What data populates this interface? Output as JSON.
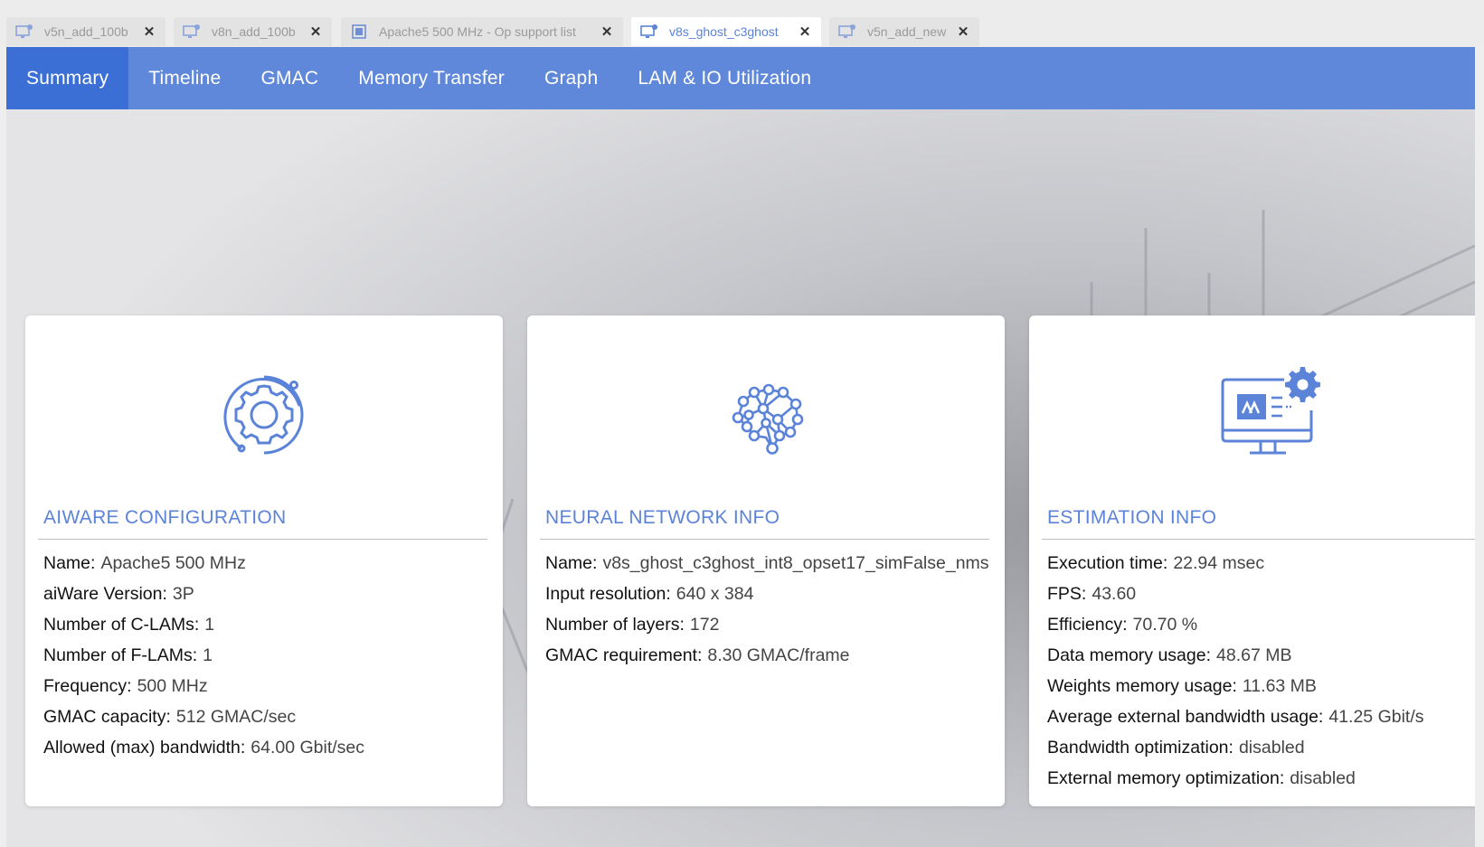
{
  "tabs": [
    {
      "label": "v5n_add_100b",
      "icon": "monitor-icon",
      "active": false
    },
    {
      "label": "v8n_add_100b",
      "icon": "monitor-icon",
      "active": false
    },
    {
      "label": "Apache5 500 MHz - Op support list",
      "icon": "chip-icon",
      "active": false
    },
    {
      "label": "v8s_ghost_c3ghost",
      "icon": "monitor-icon",
      "active": true
    },
    {
      "label": "v5n_add_new",
      "icon": "monitor-icon",
      "active": false
    }
  ],
  "nav": {
    "items": [
      "Summary",
      "Timeline",
      "GMAC",
      "Memory Transfer",
      "Graph",
      "LAM & IO Utilization"
    ],
    "active": "Summary"
  },
  "cards": {
    "aiware": {
      "icon": "gear-icon",
      "title": "AIWARE CONFIGURATION",
      "rows": [
        {
          "key": "Name:",
          "value": "Apache5 500 MHz"
        },
        {
          "key": "aiWare Version:",
          "value": "3P"
        },
        {
          "key": "Number of C-LAMs:",
          "value": "1"
        },
        {
          "key": "Number of F-LAMs:",
          "value": "1"
        },
        {
          "key": "Frequency:",
          "value": "500 MHz"
        },
        {
          "key": "GMAC capacity:",
          "value": "512 GMAC/sec"
        },
        {
          "key": "Allowed (max) bandwidth:",
          "value": "64.00 Gbit/sec"
        }
      ]
    },
    "neural": {
      "icon": "brain-network-icon",
      "title": "NEURAL NETWORK INFO",
      "rows": [
        {
          "key": "Name:",
          "value": "v8s_ghost_c3ghost_int8_opset17_simFalse_nms"
        },
        {
          "key": "Input resolution:",
          "value": "640 x 384"
        },
        {
          "key": "Number of layers:",
          "value": "172"
        },
        {
          "key": "GMAC requirement:",
          "value": "8.30 GMAC/frame"
        }
      ]
    },
    "estimation": {
      "icon": "monitor-settings-icon",
      "title": "ESTIMATION INFO",
      "rows": [
        {
          "key": "Execution time:",
          "value": "22.94 msec"
        },
        {
          "key": "FPS:",
          "value": "43.60"
        },
        {
          "key": "Efficiency:",
          "value": "70.70 %"
        },
        {
          "key": "Data memory usage:",
          "value": "48.67 MB"
        },
        {
          "key": "Weights memory usage:",
          "value": "11.63 MB"
        },
        {
          "key": "Average external bandwidth usage:",
          "value": "41.25 Gbit/s"
        },
        {
          "key": "Bandwidth optimization:",
          "value": "disabled"
        },
        {
          "key": "External memory optimization:",
          "value": "disabled"
        }
      ]
    }
  },
  "colors": {
    "accent": "#5b83d8",
    "navbar": "#6088da",
    "nav_active": "#3b6fd6"
  }
}
